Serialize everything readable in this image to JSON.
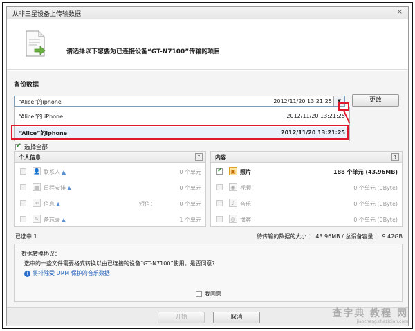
{
  "window": {
    "title": "从非三星设备上传输数据",
    "close_glyph": "×"
  },
  "header": {
    "instruction": "请选择以下您要为已连接设备“GT-N7100”传输的项目"
  },
  "backup": {
    "label": "备份数据",
    "selected_name": "“Alice”的iphone",
    "selected_date": "2012/11/20 13:21:25",
    "change_button": "更改",
    "options": [
      {
        "name": "“Alice”的 iPhone",
        "date": "2012/11/20 13:21:25"
      },
      {
        "name": "“Alice”的iphone",
        "date": "2012/11/20 13:21:25"
      }
    ]
  },
  "select_all_label": "选择全部",
  "personal_panel": {
    "title": "个人信息",
    "help": "?",
    "items": [
      {
        "label": "联系人",
        "note": "",
        "count": "0 个单元",
        "icon": "contacts-icon",
        "glyph": "👤"
      },
      {
        "label": "日程安排",
        "note": "",
        "count": "0 个单元",
        "icon": "calendar-icon",
        "glyph": "▦"
      },
      {
        "label": "信息",
        "note": "短信：",
        "count": "0 个单元",
        "icon": "message-icon",
        "glyph": "✉"
      },
      {
        "label": "备忘录",
        "note": "",
        "count": "1 个单元",
        "icon": "memo-icon",
        "glyph": "✎"
      }
    ]
  },
  "content_panel": {
    "title": "内容",
    "help": "?",
    "items": [
      {
        "label": "照片",
        "count": "188 个单元 (43.96MB)",
        "icon": "photo-icon",
        "glyph": "▣",
        "checked": true
      },
      {
        "label": "视频",
        "count": "0 个单元 (0Byte)",
        "icon": "video-icon",
        "glyph": "◉",
        "checked": false
      },
      {
        "label": "音乐",
        "count": "0 个单元 (0Byte)",
        "icon": "music-icon",
        "glyph": "♪",
        "checked": false
      },
      {
        "label": "播客",
        "count": "0 个单元 (0Byte)",
        "icon": "podcast-icon",
        "glyph": "◎",
        "checked": false
      }
    ]
  },
  "status": {
    "selected": "已选中 1",
    "transfer_size": "待传输的数据的大小 ： 43.96MB / 总设备容量 ： 9.42GB"
  },
  "agreement": {
    "title": "数据转换协议：",
    "text": "选中的一些文件需要格式转换以由已连接的设备“GT-N7100”使用。是否同意?",
    "link": "将排除受 DRM 保护的音乐数据",
    "agree_label": "我同意"
  },
  "footer": {
    "start_button": "开始",
    "cancel_button": "取消"
  },
  "watermark": {
    "main": "查字典 教程 网",
    "sub": "jiaocheng.chazidian.com"
  },
  "colors": {
    "highlight": "#e0182e",
    "link": "#1e5fb8",
    "check": "#2a8a2a"
  }
}
